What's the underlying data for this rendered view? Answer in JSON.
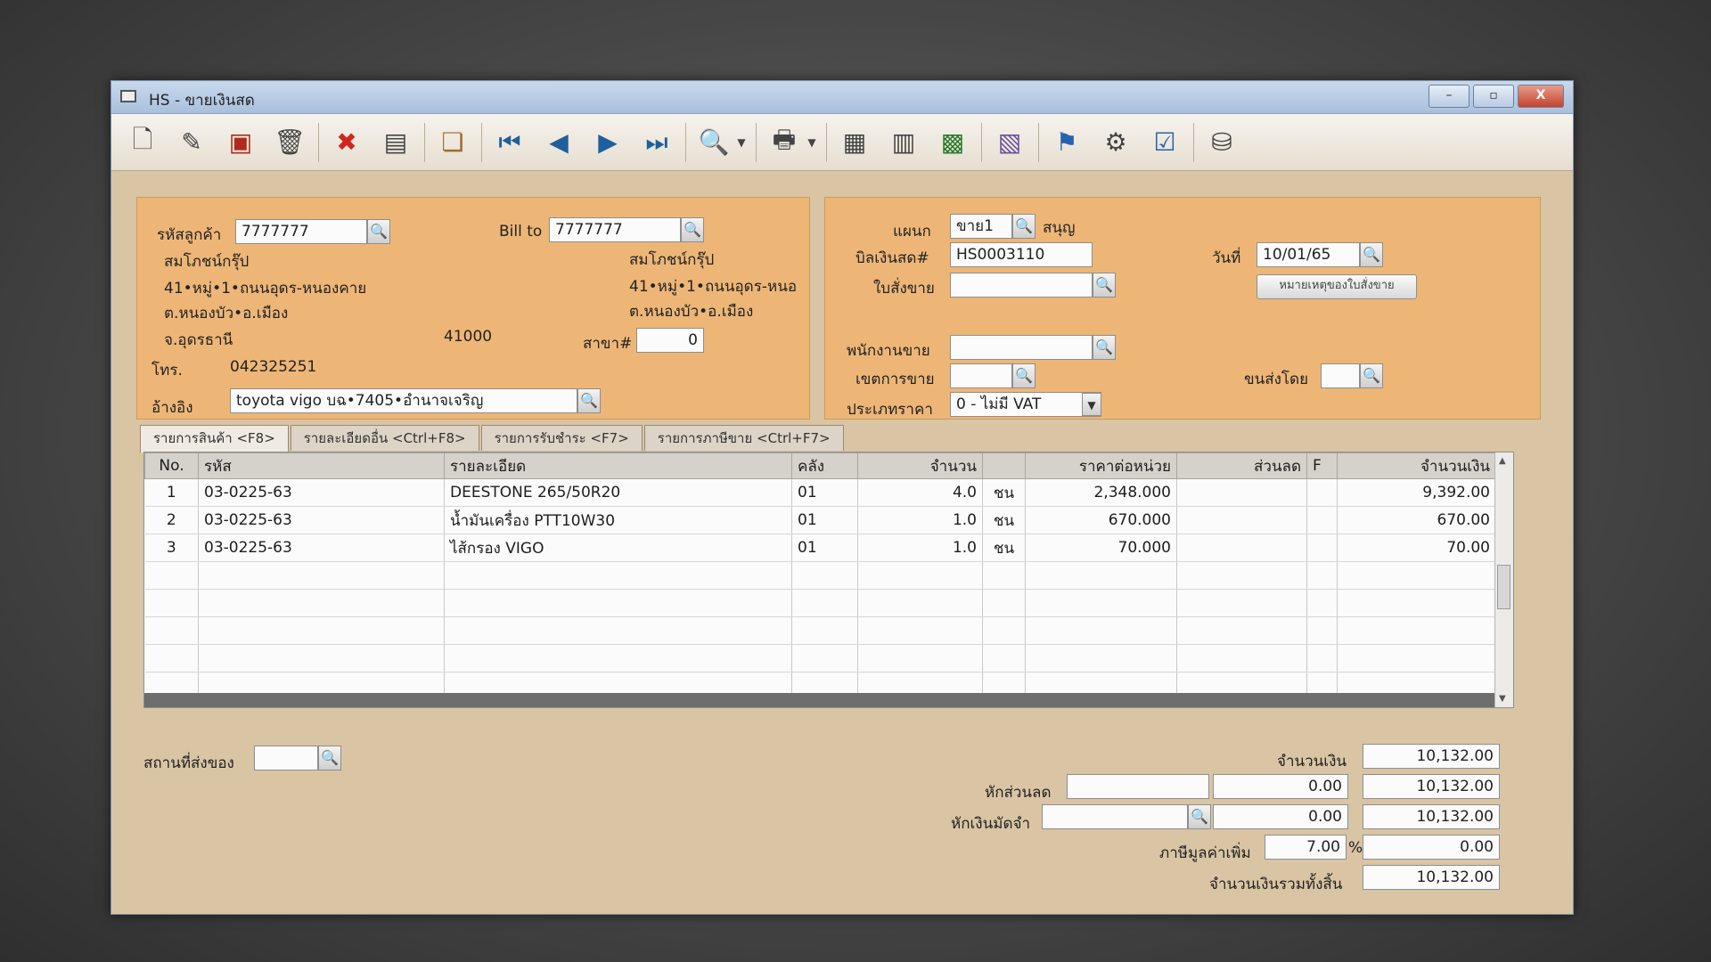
{
  "window": {
    "title": "HS - ขายเงินสด",
    "min": "–",
    "max": "▫",
    "close": "X"
  },
  "customer": {
    "code_label": "รหัสลูกค้า",
    "code": "7777777",
    "name": "สมโภชน์กรุ๊ป",
    "address1": "41•หมู่•1•ถนนอุดร-หนองคาย",
    "address2": "ต.หนองบัว•อ.เมือง",
    "province": "จ.อุดรธานี",
    "zip": "41000",
    "phone_label": "โทร.",
    "phone": "042325251",
    "ref_label": "อ้างอิง",
    "ref": "toyota vigo บฉ•7405•อำนาจเจริญ"
  },
  "bill_to": {
    "label": "Bill to",
    "code": "7777777",
    "name": "สมโภชน์กรุ๊ป",
    "address1": "41•หมู่•1•ถนนอุดร-หนอ",
    "address2": "ต.หนองบัว•อ.เมือง",
    "branch_label": "สาขา#",
    "branch": "0"
  },
  "doc": {
    "dept_label": "แผนก",
    "dept": "ขาย1",
    "dept_name": "สนุญ",
    "bill_label": "บิลเงินสด#",
    "bill_no": "HS0003110",
    "date_label": "วันที่",
    "date": "10/01/65",
    "order_label": "ใบสั่งขาย",
    "order": "",
    "order_note_btn": "หมายเหตุของใบสั่งขาย",
    "salesman_label": "พนักงานขาย",
    "salesman": "",
    "area_label": "เขตการขาย",
    "area": "",
    "ship_by_label": "ขนส่งโดย",
    "ship_by": "",
    "price_type_label": "ประเภทราคา",
    "price_type": "0 - ไม่มี VAT"
  },
  "tabs": [
    "รายการสินค้า <F8>",
    "รายละเอียดอื่น <Ctrl+F8>",
    "รายการรับชำระ <F7>",
    "รายการภาษีขาย <Ctrl+F7>"
  ],
  "grid": {
    "headers": [
      "No.",
      "รหัส",
      "รายละเอียด",
      "คลัง",
      "จำนวน",
      "",
      "ราคาต่อหน่วย",
      "ส่วนลด",
      "F",
      "จำนวนเงิน"
    ],
    "rows": [
      [
        "1",
        "03-0225-63",
        "DEESTONE 265/50R20",
        "01",
        "4.0",
        "ชน",
        "2,348.000",
        "",
        "",
        "9,392.00"
      ],
      [
        "2",
        "03-0225-63",
        "น้ำมันเครื่อง PTT10W30",
        "01",
        "1.0",
        "ชน",
        "670.000",
        "",
        "",
        "670.00"
      ],
      [
        "3",
        "03-0225-63",
        "ไส้กรอง VIGO",
        "01",
        "1.0",
        "ชน",
        "70.000",
        "",
        "",
        "70.00"
      ]
    ]
  },
  "footer": {
    "ship_place_label": "สถานที่ส่งของ",
    "ship_place": "",
    "amount_label": "จำนวนเงิน",
    "amount": "10,132.00",
    "discount_label": "หักส่วนลด",
    "discount_code": "",
    "discount": "0.00",
    "after_discount": "10,132.00",
    "deposit_label": "หักเงินมัดจำ",
    "deposit_code": "",
    "deposit": "0.00",
    "after_deposit": "10,132.00",
    "vat_label": "ภาษีมูลค่าเพิ่ม",
    "vat_rate": "7.00",
    "vat_pct": "%",
    "vat": "0.00",
    "total_label": "จำนวนเงินรวมทั้งสิ้น",
    "total": "10,132.00"
  },
  "icons": [
    "new-doc-icon",
    "edit-icon",
    "void-icon",
    "delete-icon",
    "cancel-icon",
    "save-icon",
    "copy-icon",
    "first-icon",
    "prev-icon",
    "next-icon",
    "last-icon",
    "find-icon",
    "print-icon",
    "calc-icon",
    "report-icon",
    "stat-icon",
    "refund-icon",
    "approve-icon",
    "tools-icon",
    "ok-icon",
    "network-icon"
  ]
}
